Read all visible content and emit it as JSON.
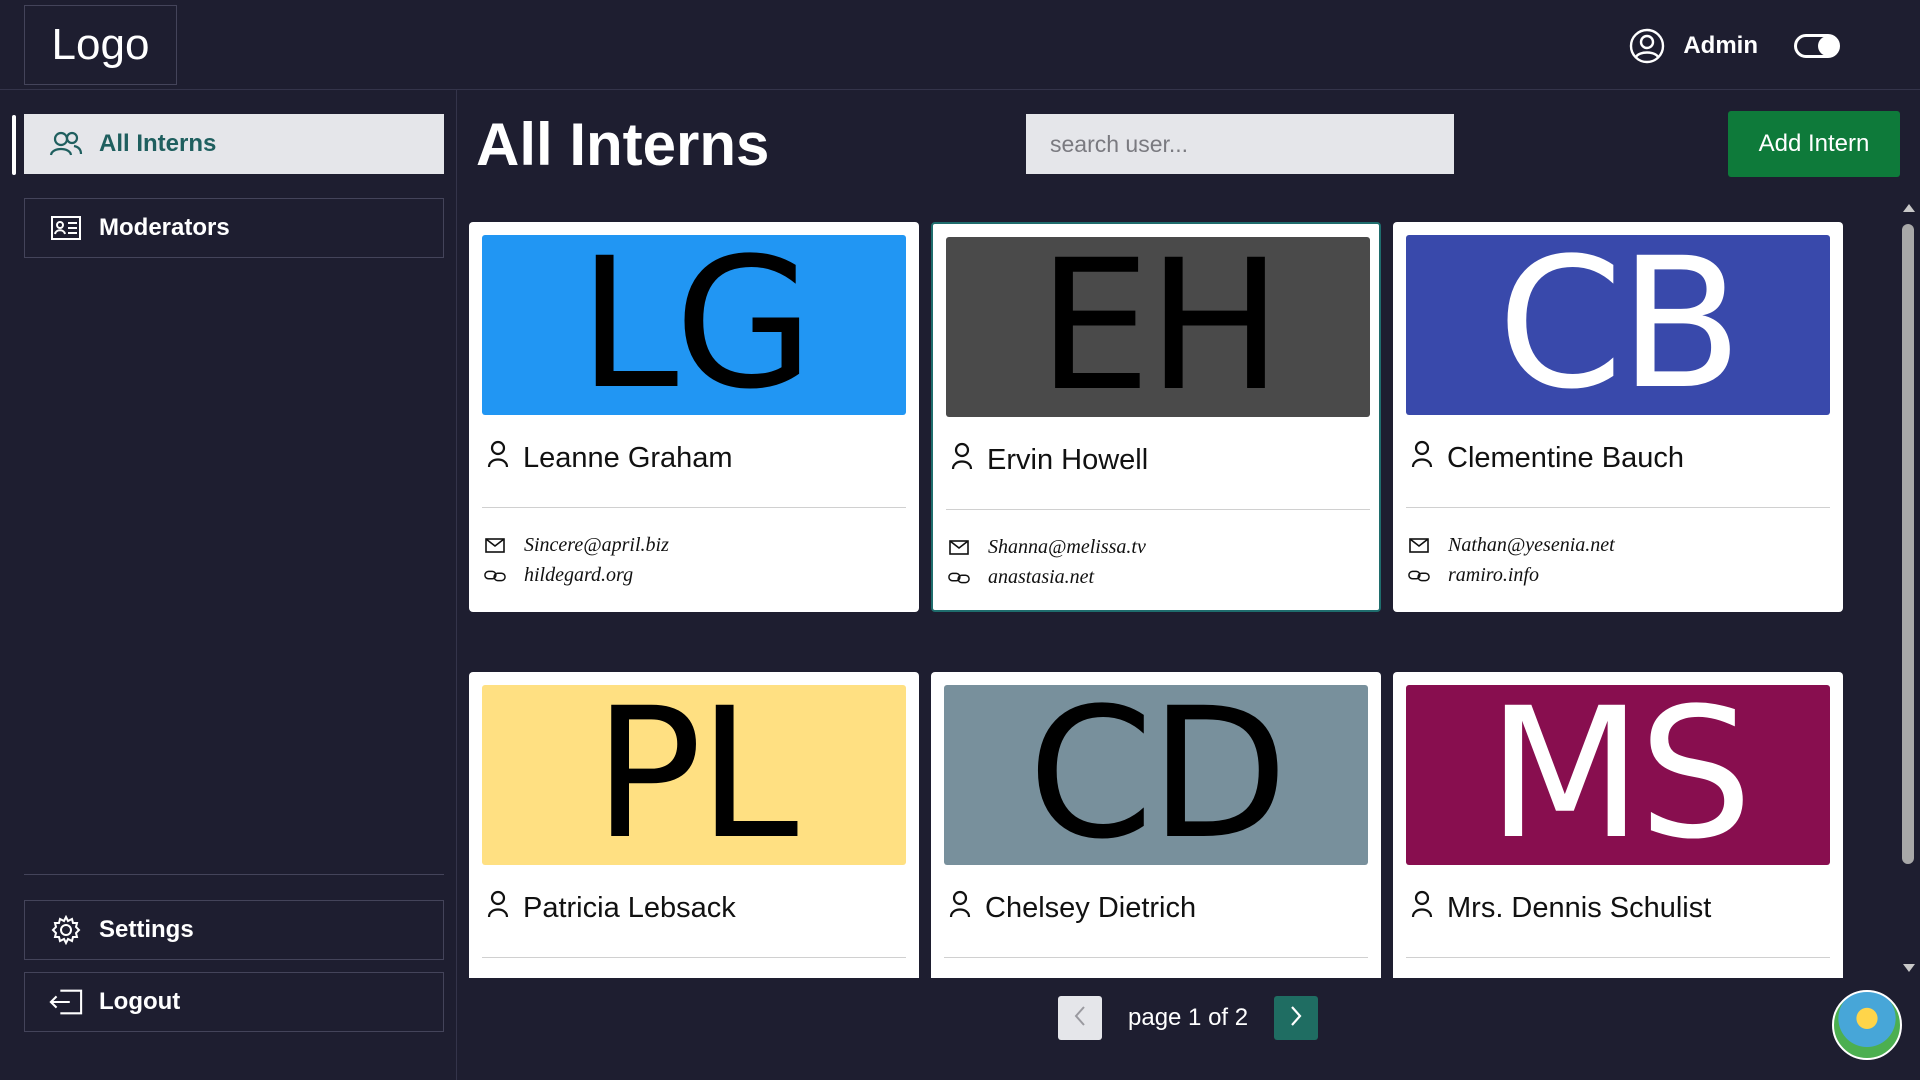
{
  "header": {
    "logo_text": "Logo",
    "user_name": "Admin",
    "toggle_on": true
  },
  "sidebar": {
    "items": [
      {
        "label": "All Interns",
        "icon": "users-icon",
        "active": true
      },
      {
        "label": "Moderators",
        "icon": "id-card-icon",
        "active": false
      }
    ],
    "bottom_items": [
      {
        "label": "Settings",
        "icon": "gear-icon"
      },
      {
        "label": "Logout",
        "icon": "logout-icon"
      }
    ]
  },
  "main": {
    "title": "All Interns",
    "search_placeholder": "search user...",
    "add_button_label": "Add Intern"
  },
  "cards": [
    {
      "initials": "LG",
      "bg": "#2196f3",
      "fg": "#000000",
      "name": "Leanne Graham",
      "email": "Sincere@april.biz",
      "website": "hildegard.org"
    },
    {
      "initials": "EH",
      "bg": "#4a4a4a",
      "fg": "#000000",
      "name": "Ervin Howell",
      "email": "Shanna@melissa.tv",
      "website": "anastasia.net"
    },
    {
      "initials": "CB",
      "bg": "#3949ab",
      "fg": "#ffffff",
      "name": "Clementine Bauch",
      "email": "Nathan@yesenia.net",
      "website": "ramiro.info"
    },
    {
      "initials": "PL",
      "bg": "#ffe082",
      "fg": "#000000",
      "name": "Patricia Lebsack",
      "email": "",
      "website": ""
    },
    {
      "initials": "CD",
      "bg": "#78909c",
      "fg": "#000000",
      "name": "Chelsey Dietrich",
      "email": "",
      "website": ""
    },
    {
      "initials": "MS",
      "bg": "#880e4f",
      "fg": "#ffffff",
      "name": "Mrs. Dennis Schulist",
      "email": "",
      "website": ""
    }
  ],
  "pagination": {
    "label": "page 1 of 2",
    "current": 1,
    "total": 2
  },
  "colors": {
    "background": "#1e1e30",
    "accent": "#1f6d62",
    "add_button": "#0e7a3a"
  }
}
